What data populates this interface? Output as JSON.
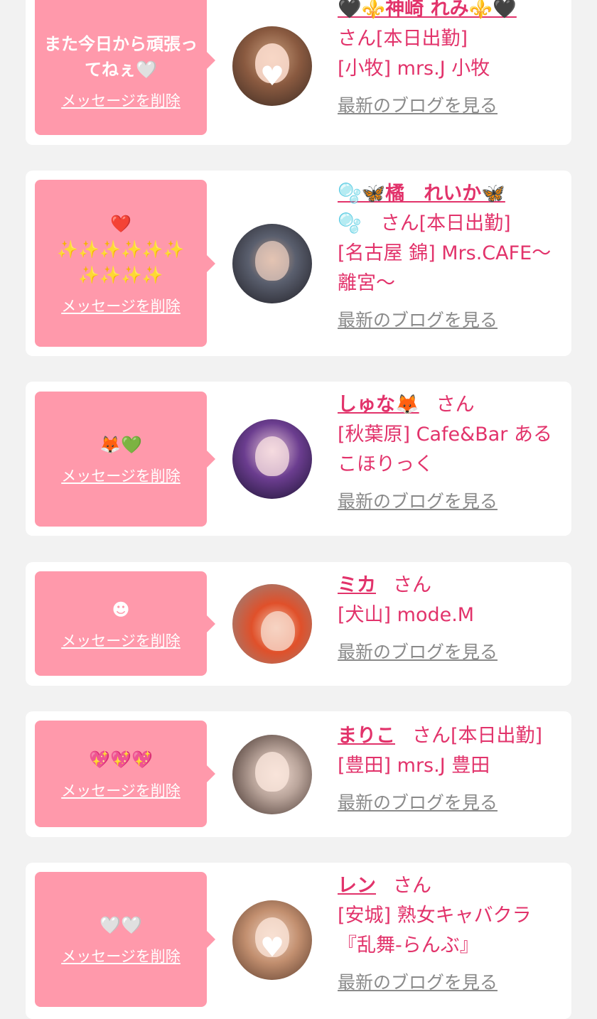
{
  "cards": [
    {
      "message": "また今日から頑張ってねぇ🤍",
      "delete_label": "メッセージを削除",
      "name": "🖤⚜️神崎 れみ⚜️🖤",
      "suffix": "さん",
      "status": "[本日出勤]",
      "shop": "[小牧] mrs.J 小牧",
      "blog_label": "最新のブログを見る",
      "avatar_colors": [
        "#caa07f",
        "#3a2a22"
      ]
    },
    {
      "message": "❤️\n✨✨✨✨✨✨✨✨✨✨",
      "delete_label": "メッセージを削除",
      "name": "🫧🦋橘　れいか🦋",
      "suffix": "🫧　さん",
      "status": "[本日出勤]",
      "shop": "[名古屋 錦] Mrs.CAFE〜離宮〜",
      "blog_label": "最新のブログを見る",
      "avatar_colors": [
        "#5a5f6e",
        "#1e1c22"
      ]
    },
    {
      "message": "🦊💚",
      "delete_label": "メッセージを削除",
      "name": "しゅな🦊",
      "suffix": "さん",
      "status": "",
      "shop": "[秋葉原] Cafe&Bar あるこほりっく",
      "blog_label": "最新のブログを見る",
      "avatar_colors": [
        "#6b3d8f",
        "#1a1230"
      ]
    },
    {
      "message": "☻",
      "delete_label": "メッセージを削除",
      "name": "ミカ",
      "suffix": "さん",
      "status": "",
      "shop": "[犬山] mode.M",
      "blog_label": "最新のブログを見る",
      "avatar_colors": [
        "#e0502a",
        "#8a8a8a"
      ]
    },
    {
      "message": "💖💖💖",
      "delete_label": "メッセージを削除",
      "name": "まりこ",
      "suffix": "さん",
      "status": "[本日出勤]",
      "shop": "[豊田] mrs.J 豊田",
      "blog_label": "最新のブログを見る",
      "avatar_colors": [
        "#b9a49a",
        "#3b2a25"
      ]
    },
    {
      "message": "🤍🤍",
      "delete_label": "メッセージを削除",
      "name": "レン",
      "suffix": "さん",
      "status": "",
      "shop": "[安城] 熟女キャバクラ『乱舞-らんぶ』",
      "blog_label": "最新のブログを見る",
      "avatar_colors": [
        "#c28f6f",
        "#5a3b2c"
      ]
    }
  ]
}
